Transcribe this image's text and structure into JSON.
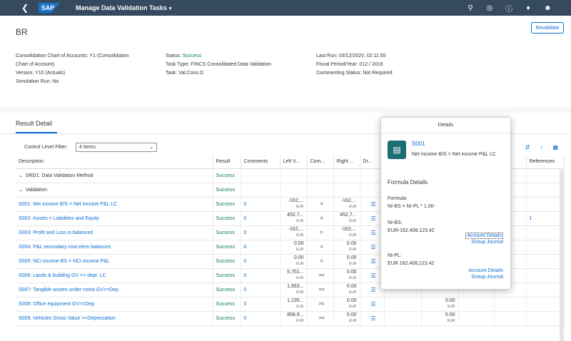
{
  "shell": {
    "back_icon": "back-icon",
    "logo": "SAP",
    "title": "Manage Data Validation Tasks",
    "title_caret": "▾",
    "icons": [
      "search-icon",
      "copilot-icon",
      "help-icon",
      "bell-icon",
      "user-icon"
    ]
  },
  "header": {
    "title": "BR",
    "revalidate": "Revalidate",
    "col1": [
      "Consolidation Chart of Accounts: Y1 (Consolidation",
      "Chart of Account)",
      "Version: Y10 (Actuals)",
      "Simulation Run: No"
    ],
    "status_label": "Status:",
    "status_value": "Success",
    "task_type": "Task Type: FINCS Consolidated Data Validation",
    "task": "Task: Val.Cons.D",
    "last_run": "Last Run: 03/12/2020, 02:11:55",
    "fiscal": "Fiscal Period/Year: 012 / 2019",
    "commenting": "Commenting Status: Not Required"
  },
  "section": {
    "title": "Result Detail",
    "filter_label": "Control Level Filter:",
    "filter_value": "4 Items",
    "filter_chevron": "⌄",
    "tool_icons": [
      "sort-icon",
      "sort-ascending-icon",
      "export-icon"
    ]
  },
  "table": {
    "headers": [
      "Description",
      "Result",
      "Comments",
      "Left V...",
      "Com...",
      "Right ...",
      "Dr...",
      "",
      "",
      "",
      "",
      "References"
    ],
    "rows": [
      {
        "desc": "SRD1: Data Validation Method",
        "result": "Success",
        "level": 0
      },
      {
        "desc": "Validation",
        "result": "Success",
        "level": 1
      },
      {
        "desc": "S001: Net income B/S = Net income P&L LC",
        "result": "Success",
        "comments": "0",
        "left": "-162,...",
        "left_unit": "EUR",
        "op": "=",
        "right": "-162,...",
        "right_unit": "EUR",
        "level": 2
      },
      {
        "desc": "S002: Assets = Liabilities and Equity",
        "result": "Success",
        "comments": "0",
        "left": "452,7...",
        "left_unit": "EUR",
        "op": "=",
        "right": "452,7...",
        "right_unit": "EUR",
        "refs": "1",
        "level": 2
      },
      {
        "desc": "S003: Profit and Loss is balanced",
        "result": "Success",
        "comments": "0",
        "left": "-162,...",
        "left_unit": "EUR",
        "op": "=",
        "right": "-162,...",
        "right_unit": "EUR",
        "level": 2
      },
      {
        "desc": "S004: P&L secondary cost elem balances",
        "result": "Success",
        "comments": "0",
        "left": "0.00",
        "left_unit": "EUR",
        "op": "=",
        "right": "0.00",
        "right_unit": "EUR",
        "level": 2
      },
      {
        "desc": "S005: NCI income BS = NCI income P&L",
        "result": "Success",
        "comments": "0",
        "left": "0.00",
        "left_unit": "EUR",
        "op": "=",
        "right": "0.00",
        "right_unit": "EUR",
        "level": 2
      },
      {
        "desc": "S006: Lands & building GV >= depr. LC",
        "result": "Success",
        "comments": "0",
        "left": "5,751...",
        "left_unit": "EUR",
        "op": ">=",
        "right": "0.00",
        "right_unit": "EUR",
        "level": 2
      },
      {
        "desc": "S007: Tangible assets under const GV>=Dep",
        "result": "Success",
        "comments": "0",
        "left": "1,563...",
        "left_unit": "EUR",
        "op": ">=",
        "right": "0.00",
        "right_unit": "EUR",
        "level": 2
      },
      {
        "desc": "S008: Office equipment GV>=Dep",
        "result": "Success",
        "comments": "0",
        "left": "1,135...",
        "left_unit": "EUR",
        "op": ">=",
        "right": "0.00",
        "right_unit": "EUR",
        "extra": "0.00",
        "extra_unit": "EUR",
        "level": 2
      },
      {
        "desc": "S009: Vehicles Gross Value >=Depreciation",
        "result": "Success",
        "comments": "0",
        "left": "858,9...",
        "left_unit": "EUR",
        "op": ">=",
        "right": "0.00",
        "right_unit": "EUR",
        "extra": "0.00",
        "extra_unit": "EUR",
        "level": 2
      }
    ]
  },
  "popover": {
    "title": "Details",
    "icon": "validation-icon",
    "id": "S001",
    "desc": "Net income B/S = Net income P&L LC",
    "formula_heading": "Formula Details",
    "formula_label": "Formula:",
    "formula": "NI-BS = NI-PL * 1.00-",
    "nibs_label": "NI-BS:",
    "nibs_value": "EUR-162,408,123.42",
    "nipl_label": "NI-PL:",
    "nipl_value": "EUR 162,408,123.42",
    "link_account": "Account Details",
    "link_journal": "Group Journal"
  }
}
